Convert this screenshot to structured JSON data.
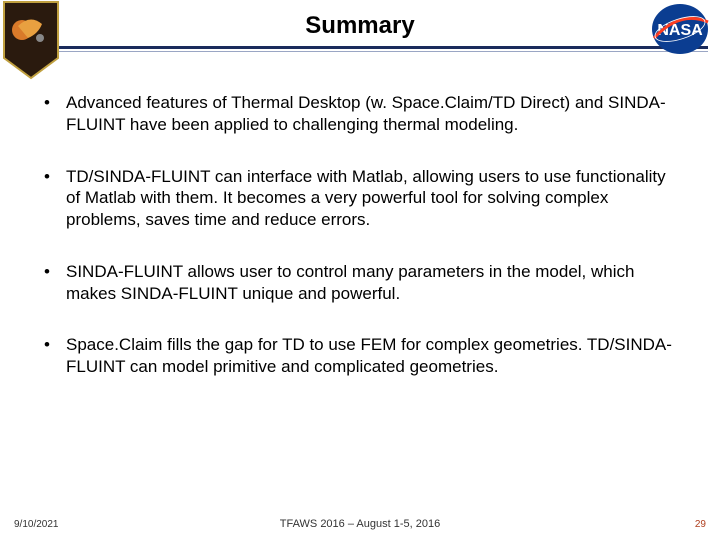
{
  "header": {
    "title": "Summary"
  },
  "bullets": {
    "b1": "Advanced features of Thermal Desktop (w. Space.Claim/TD Direct) and SINDA-FLUINT have been applied to challenging thermal modeling.",
    "b2": "TD/SINDA-FLUINT can interface with Matlab, allowing users to use functionality of Matlab with them. It becomes a very powerful tool for solving complex problems, saves time and reduce errors.",
    "b3": "SINDA-FLUINT allows user to control many parameters in the model, which makes SINDA-FLUINT unique and powerful.",
    "b4": "Space.Claim fills the gap for TD to use FEM for complex geometries. TD/SINDA-FLUINT can model primitive and complicated geometries."
  },
  "footer": {
    "date": "9/10/2021",
    "center": "TFAWS 2016 – August 1-5, 2016",
    "page": "29"
  }
}
